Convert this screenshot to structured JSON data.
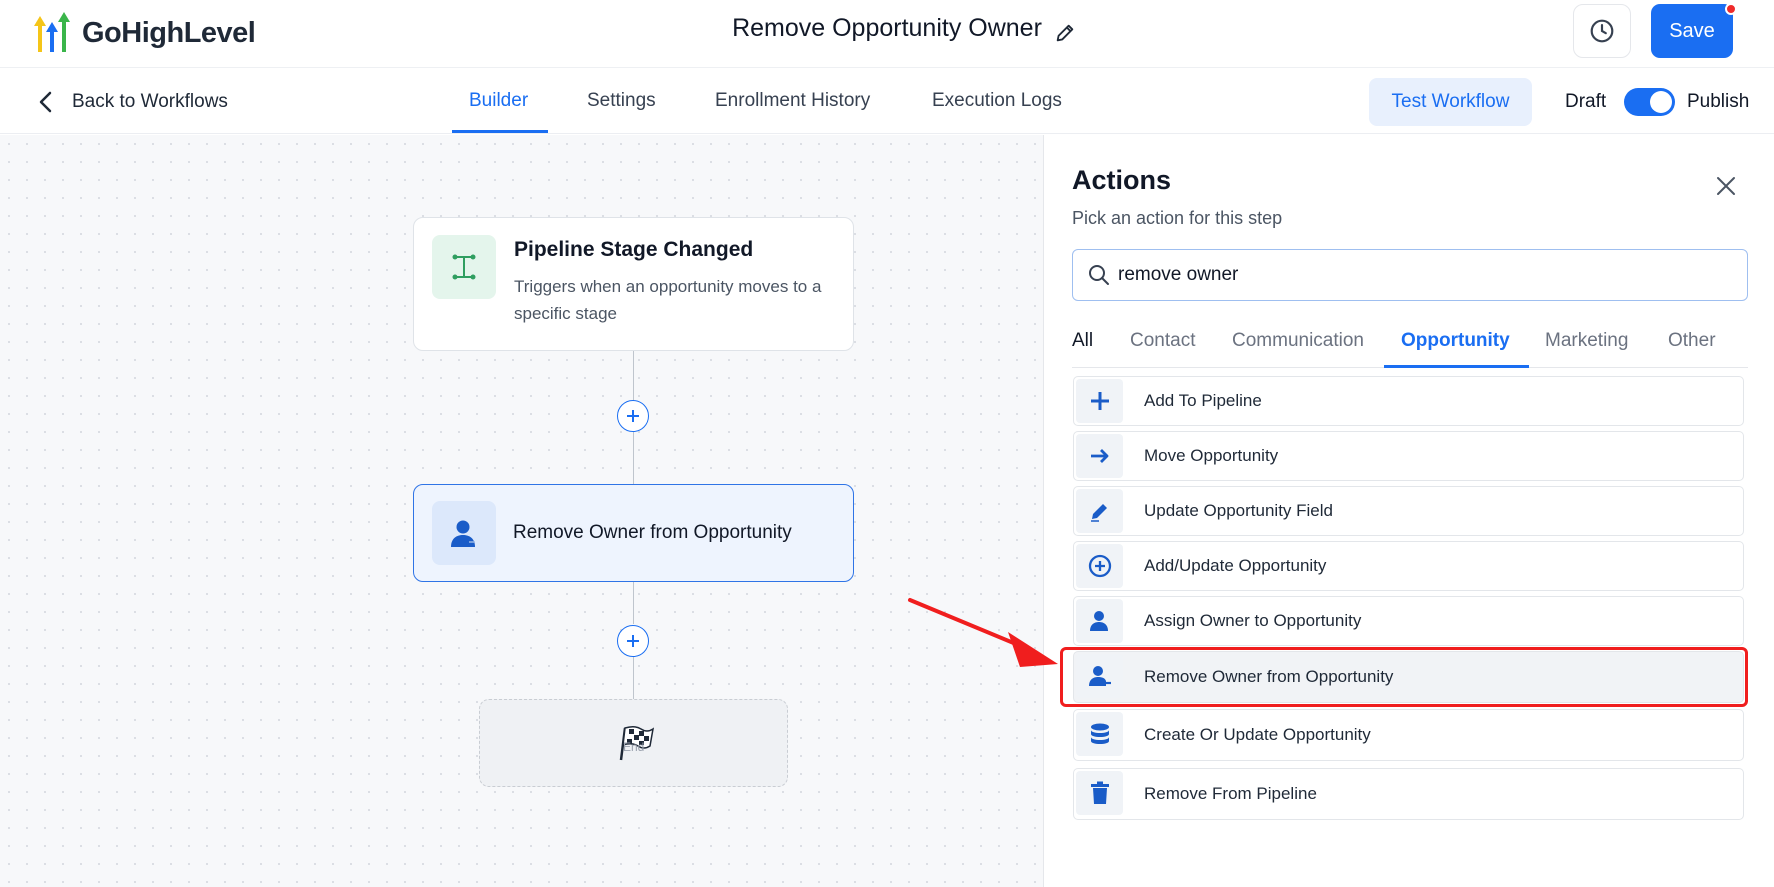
{
  "header": {
    "logo_text": "GoHighLevel",
    "workflow_title": "Remove Opportunity Owner",
    "save_label": "Save",
    "history_icon": "clock-icon",
    "edit_icon": "pencil-icon"
  },
  "subnav": {
    "back_label": "Back to Workflows",
    "tabs": [
      {
        "label": "Builder",
        "active": true
      },
      {
        "label": "Settings",
        "active": false
      },
      {
        "label": "Enrollment History",
        "active": false
      },
      {
        "label": "Execution Logs",
        "active": false
      }
    ],
    "test_label": "Test Workflow",
    "draft_label": "Draft",
    "publish_label": "Publish",
    "published": true
  },
  "canvas": {
    "trigger": {
      "title": "Pipeline Stage Changed",
      "description": "Triggers when an opportunity moves to a specific stage",
      "icon": "pipeline-icon"
    },
    "action": {
      "title": "Remove Owner from Opportunity",
      "icon": "user-icon"
    },
    "end_label": "End"
  },
  "panel": {
    "title": "Actions",
    "subtitle": "Pick an action for this step",
    "search_value": "remove owner",
    "categories": [
      {
        "label": "All",
        "active": false
      },
      {
        "label": "Contact",
        "active": false
      },
      {
        "label": "Communication",
        "active": false
      },
      {
        "label": "Opportunity",
        "active": true
      },
      {
        "label": "Marketing",
        "active": false
      },
      {
        "label": "Other",
        "active": false
      }
    ],
    "items": [
      {
        "label": "Add To Pipeline",
        "icon": "plus-icon"
      },
      {
        "label": "Move Opportunity",
        "icon": "arrow-right-icon"
      },
      {
        "label": "Update Opportunity Field",
        "icon": "pencil-icon"
      },
      {
        "label": "Add/Update Opportunity",
        "icon": "plus-circle-icon"
      },
      {
        "label": "Assign Owner to Opportunity",
        "icon": "user-icon"
      },
      {
        "label": "Remove Owner from Opportunity",
        "icon": "user-remove-icon",
        "highlighted": true
      },
      {
        "label": "Create Or Update Opportunity",
        "icon": "database-icon"
      },
      {
        "label": "Remove From Pipeline",
        "icon": "trash-icon"
      }
    ]
  },
  "colors": {
    "accent": "#1a6ef2",
    "annotation": "#f01e1e"
  }
}
